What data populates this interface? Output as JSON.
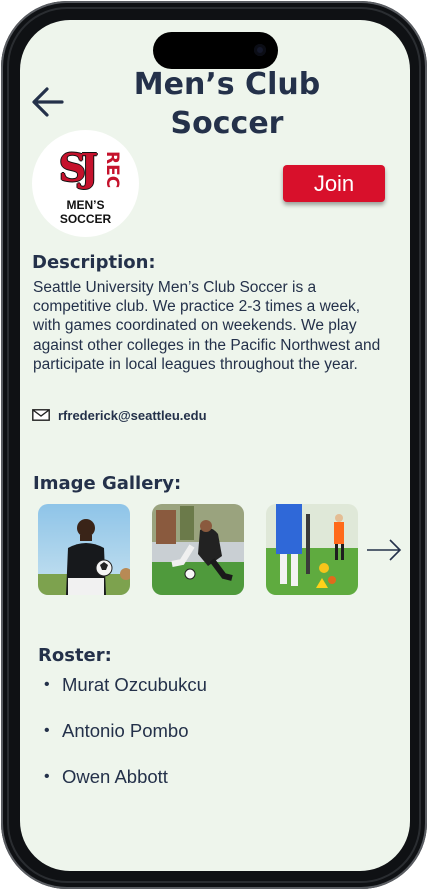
{
  "header": {
    "title": "Men’s Club Soccer"
  },
  "logo": {
    "initials": "SJ",
    "rec": "REC",
    "line1": "MEN’S",
    "line2": "SOCCER"
  },
  "join": {
    "label": "Join"
  },
  "description": {
    "heading": "Description:",
    "text": "Seattle University Men’s Club Soccer is a competitive club.  We practice 2-3 times a week, with games coordinated on weekends. We play against other colleges in the Pacific Northwest and participate in local leagues throughout the year."
  },
  "contact": {
    "email": "rfrederick@seattleu.edu"
  },
  "gallery": {
    "heading": "Image Gallery:",
    "images": [
      "player-holding-ball",
      "players-tackling",
      "training-drill"
    ]
  },
  "roster": {
    "heading": "Roster:",
    "members": [
      "Murat Ozcubukcu",
      "Antonio Pombo",
      "Owen Abbott"
    ]
  },
  "colors": {
    "background": "#eef5ec",
    "text": "#24314a",
    "accent": "#d8102b"
  }
}
